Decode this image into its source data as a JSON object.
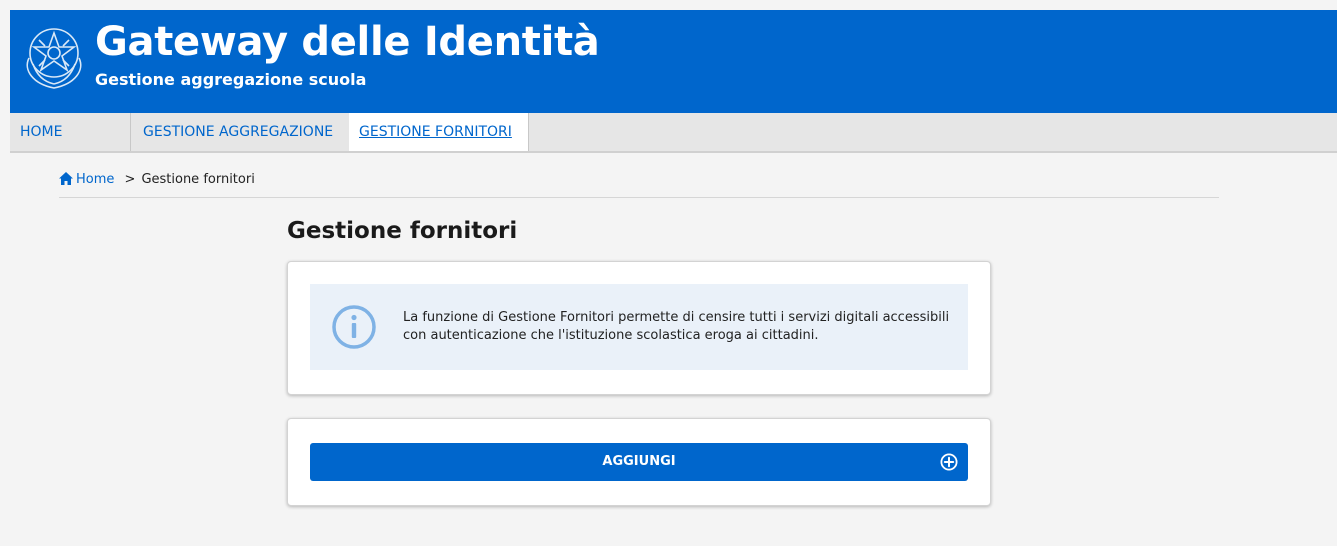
{
  "header": {
    "title": "Gateway delle Identità",
    "subtitle": "Gestione aggregazione scuola",
    "emblem_icon": "italian-republic-emblem-icon",
    "background": "#0066cc"
  },
  "nav": {
    "items": [
      {
        "label": "HOME"
      },
      {
        "label": "GESTIONE AGGREGAZIONE"
      },
      {
        "label": "GESTIONE FORNITORI",
        "active": true
      }
    ]
  },
  "breadcrumb": {
    "home_icon": "home-icon",
    "home": "Home",
    "separator": ">",
    "current": "Gestione fornitori"
  },
  "main": {
    "title": "Gestione fornitori",
    "info": {
      "icon": "info-circle-icon",
      "text": "La funzione di Gestione Fornitori permette di censire tutti i servizi digitali accessibili con autenticazione che l'istituzione scolastica eroga ai cittadini."
    },
    "add_button": {
      "label": "AGGIUNGI",
      "icon": "plus-circle-icon"
    }
  },
  "colors": {
    "accent": "#0066cc",
    "info_bg": "#eaf1f9",
    "info_icon": "#7fb2e5"
  }
}
